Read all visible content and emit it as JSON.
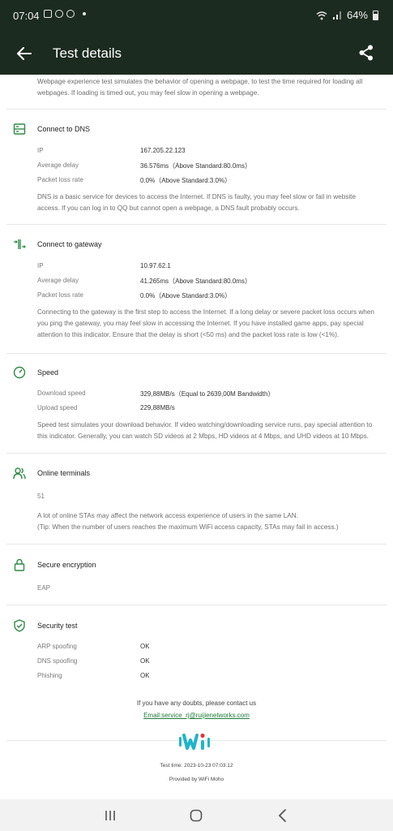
{
  "status_bar": {
    "time": "07:04",
    "battery": "64%"
  },
  "header": {
    "title": "Test details"
  },
  "intro": {
    "text": "Webpage experience test simulates the behavior of opening a webpage, to test the time required for loading all webpages. If loading is timed out, you may feel slow in opening a webpage."
  },
  "dns": {
    "title": "Connect to DNS",
    "ip_label": "IP",
    "ip_value": "167.205.22.123",
    "delay_label": "Average delay",
    "delay_value": "36.576ms（Above Standard:80.0ms）",
    "loss_label": "Packet loss rate",
    "loss_value": "0.0%（Above Standard:3.0%）",
    "desc": "DNS is a basic service for devices to access the Internet. If DNS is faulty, you may feel slow or fail in website access. If you can log in to QQ but cannot open a webpage, a DNS fault probably occurs."
  },
  "gateway": {
    "title": "Connect to gateway",
    "ip_label": "IP",
    "ip_value": "10.97.62.1",
    "delay_label": "Average delay",
    "delay_value": "41.265ms（Above Standard:80.0ms）",
    "loss_label": "Packet loss rate",
    "loss_value": "0.0%（Above Standard:3.0%）",
    "desc": "Connecting to the gateway is the first step to access the Internet. If a long delay or severe packet loss occurs when you ping the gateway, you may feel slow in accessing the Internet. If you have installed game apps, pay special attention to this indicator. Ensure that the delay is short (<50 ms) and the packet loss rate is low (<1%)."
  },
  "speed": {
    "title": "Speed",
    "download_label": "Download speed",
    "download_value": "329,88MB/s（Equal to 2639,00M Bandwidth）",
    "upload_label": "Upload speed",
    "upload_value": "229,88MB/s",
    "desc": "Speed test simulates your download behavior. If video watching/downloading service runs, pay special attention to this indicator. Generally, you can watch SD videos at 2 Mbps, HD videos at 4 Mbps, and UHD videos at 10 Mbps."
  },
  "terminals": {
    "title": "Online terminals",
    "count": "51",
    "desc1": "A lot of online STAs may affect the network access experience of users in the same LAN.",
    "desc2": "(Tip: When the number of users reaches the maximum WiFi access capacity, STAs may fail in access.)"
  },
  "encryption": {
    "title": "Secure encryption",
    "value": "EAP"
  },
  "security": {
    "title": "Security test",
    "rows": [
      {
        "label": "ARP spoofing",
        "value": "OK"
      },
      {
        "label": "DNS spoofing",
        "value": "OK"
      },
      {
        "label": "Phishing",
        "value": "OK"
      }
    ]
  },
  "contact": {
    "text": "If you have any doubts, please contact us",
    "email": "Email:service_rj@ruijienetworks.com"
  },
  "footer": {
    "test_time": "Test time: 2023-10-23 07:03:12",
    "provided_by": "Provided by WiFi Moho"
  },
  "colors": {
    "accent": "#2e8b47",
    "header_bg": "#1c2b1f",
    "logo_cyan": "#1fb5c9",
    "logo_red": "#e0373b"
  }
}
